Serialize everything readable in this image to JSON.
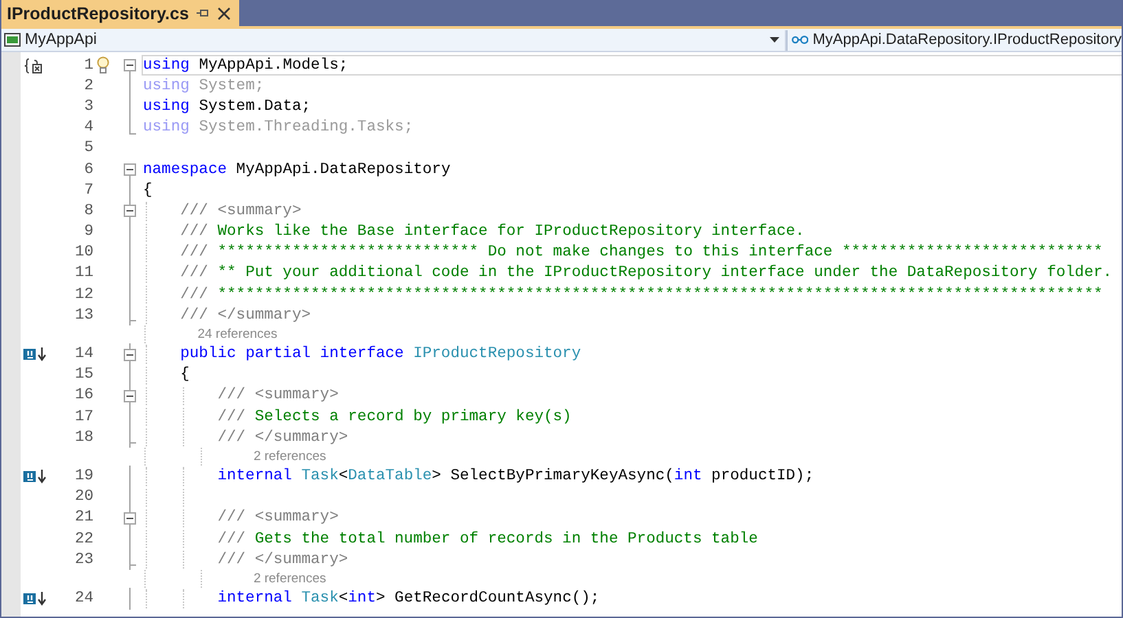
{
  "tab": {
    "title": "IProductRepository.cs",
    "selected": true
  },
  "nav_bar": {
    "project": "MyAppApi",
    "member": "MyAppApi.DataRepository.IProductRepository"
  },
  "editor": {
    "lines": [
      {
        "number": "1",
        "collapsible": true,
        "fold_end": false,
        "current": true,
        "lightbulb": true,
        "implementation_marker": false,
        "tokens": [
          {
            "kind": "keyword",
            "text": "using "
          },
          {
            "kind": "plain",
            "text": "MyAppApi.Models;"
          }
        ]
      },
      {
        "number": "2",
        "collapsible": false,
        "fold_end": false,
        "current": false,
        "lightbulb": false,
        "implementation_marker": false,
        "tokens": [
          {
            "kind": "dim-keyword",
            "text": "using "
          },
          {
            "kind": "dim",
            "text": "System;"
          }
        ]
      },
      {
        "number": "3",
        "collapsible": false,
        "fold_end": false,
        "current": false,
        "lightbulb": false,
        "implementation_marker": false,
        "tokens": [
          {
            "kind": "keyword",
            "text": "using "
          },
          {
            "kind": "plain",
            "text": "System.Data;"
          }
        ]
      },
      {
        "number": "4",
        "collapsible": false,
        "fold_end": true,
        "current": false,
        "lightbulb": false,
        "implementation_marker": false,
        "tokens": [
          {
            "kind": "dim-keyword",
            "text": "using "
          },
          {
            "kind": "dim",
            "text": "System.Threading.Tasks;"
          }
        ]
      },
      {
        "number": "5",
        "collapsible": false,
        "fold_end": false,
        "current": false,
        "lightbulb": false,
        "implementation_marker": false
      },
      {
        "number": "6",
        "collapsible": true,
        "fold_end": false,
        "current": false,
        "lightbulb": false,
        "implementation_marker": false,
        "tokens": [
          {
            "kind": "keyword",
            "text": "namespace "
          },
          {
            "kind": "plain",
            "text": "MyAppApi.DataRepository"
          }
        ]
      },
      {
        "number": "7",
        "collapsible": false,
        "fold_end": false,
        "current": false,
        "lightbulb": false,
        "implementation_marker": false,
        "tokens": [
          {
            "kind": "plain",
            "text": "{"
          }
        ],
        "children": [
          {
            "number": "8",
            "collapsible": true,
            "fold_end": false,
            "current": false,
            "lightbulb": false,
            "implementation_marker": false,
            "tokens": [
              {
                "kind": "doc",
                "text": "/// <summary>"
              }
            ]
          },
          {
            "number": "9",
            "collapsible": false,
            "fold_end": false,
            "current": false,
            "lightbulb": false,
            "implementation_marker": false,
            "tokens": [
              {
                "kind": "doc",
                "text": "///"
              },
              {
                "kind": "comment",
                "text": " Works like the Base interface for IProductRepository interface."
              }
            ]
          },
          {
            "number": "10",
            "collapsible": false,
            "fold_end": false,
            "current": false,
            "lightbulb": false,
            "implementation_marker": false,
            "tokens": [
              {
                "kind": "doc",
                "text": "///"
              },
              {
                "kind": "comment",
                "text": " **************************** Do not make changes to this interface ****************************"
              }
            ]
          },
          {
            "number": "11",
            "collapsible": false,
            "fold_end": false,
            "current": false,
            "lightbulb": false,
            "implementation_marker": false,
            "tokens": [
              {
                "kind": "doc",
                "text": "///"
              },
              {
                "kind": "comment",
                "text": " ** Put your additional code in the IProductRepository interface under the DataRepository folder."
              }
            ]
          },
          {
            "number": "12",
            "collapsible": false,
            "fold_end": false,
            "current": false,
            "lightbulb": false,
            "implementation_marker": false,
            "tokens": [
              {
                "kind": "doc",
                "text": "///"
              },
              {
                "kind": "comment",
                "text": " ***********************************************************************************************"
              }
            ]
          },
          {
            "number": "13",
            "collapsible": false,
            "fold_end": true,
            "current": false,
            "lightbulb": false,
            "implementation_marker": false,
            "tokens": [
              {
                "kind": "doc",
                "text": "/// </summary>"
              }
            ]
          },
          {
            "number": "14",
            "collapsible": true,
            "fold_end": false,
            "current": false,
            "lightbulb": false,
            "implementation_marker": true,
            "references": "24 references",
            "tokens": [
              {
                "kind": "keyword",
                "text": "public partial interface "
              },
              {
                "kind": "type",
                "text": "IProductRepository"
              }
            ]
          },
          {
            "number": "15",
            "collapsible": false,
            "fold_end": false,
            "current": false,
            "lightbulb": false,
            "implementation_marker": false,
            "tokens": [
              {
                "kind": "plain",
                "text": "{"
              }
            ],
            "children": [
              {
                "number": "16",
                "collapsible": true,
                "fold_end": false,
                "current": false,
                "lightbulb": false,
                "implementation_marker": false,
                "tokens": [
                  {
                    "kind": "doc",
                    "text": "/// <summary>"
                  }
                ]
              },
              {
                "number": "17",
                "collapsible": false,
                "fold_end": false,
                "current": false,
                "lightbulb": false,
                "implementation_marker": false,
                "tokens": [
                  {
                    "kind": "doc",
                    "text": "///"
                  },
                  {
                    "kind": "comment",
                    "text": " Selects a record by primary key(s)"
                  }
                ]
              },
              {
                "number": "18",
                "collapsible": false,
                "fold_end": true,
                "current": false,
                "lightbulb": false,
                "implementation_marker": false,
                "tokens": [
                  {
                    "kind": "doc",
                    "text": "/// </summary>"
                  }
                ]
              },
              {
                "number": "19",
                "collapsible": false,
                "fold_end": false,
                "current": false,
                "lightbulb": false,
                "implementation_marker": true,
                "references": "2 references",
                "tokens": [
                  {
                    "kind": "keyword",
                    "text": "internal "
                  },
                  {
                    "kind": "type",
                    "text": "Task"
                  },
                  {
                    "kind": "plain",
                    "text": "<"
                  },
                  {
                    "kind": "type",
                    "text": "DataTable"
                  },
                  {
                    "kind": "plain",
                    "text": "> SelectByPrimaryKeyAsync("
                  },
                  {
                    "kind": "keyword",
                    "text": "int"
                  },
                  {
                    "kind": "plain",
                    "text": " productID);"
                  }
                ]
              },
              {
                "number": "20",
                "collapsible": false,
                "fold_end": false,
                "current": false,
                "lightbulb": false,
                "implementation_marker": false
              },
              {
                "number": "21",
                "collapsible": true,
                "fold_end": false,
                "current": false,
                "lightbulb": false,
                "implementation_marker": false,
                "tokens": [
                  {
                    "kind": "doc",
                    "text": "/// <summary>"
                  }
                ]
              },
              {
                "number": "22",
                "collapsible": false,
                "fold_end": false,
                "current": false,
                "lightbulb": false,
                "implementation_marker": false,
                "tokens": [
                  {
                    "kind": "doc",
                    "text": "///"
                  },
                  {
                    "kind": "comment",
                    "text": " Gets the total number of records in the Products table"
                  }
                ]
              },
              {
                "number": "23",
                "collapsible": false,
                "fold_end": true,
                "current": false,
                "lightbulb": false,
                "implementation_marker": false,
                "tokens": [
                  {
                    "kind": "doc",
                    "text": "/// </summary>"
                  }
                ]
              },
              {
                "number": "24",
                "collapsible": false,
                "fold_end": false,
                "current": false,
                "lightbulb": false,
                "implementation_marker": true,
                "references": "2 references",
                "tokens": [
                  {
                    "kind": "keyword",
                    "text": "internal "
                  },
                  {
                    "kind": "type",
                    "text": "Task"
                  },
                  {
                    "kind": "plain",
                    "text": "<"
                  },
                  {
                    "kind": "keyword",
                    "text": "int"
                  },
                  {
                    "kind": "plain",
                    "text": "> GetRecordCountAsync();"
                  }
                ]
              }
            ]
          }
        ]
      }
    ]
  }
}
